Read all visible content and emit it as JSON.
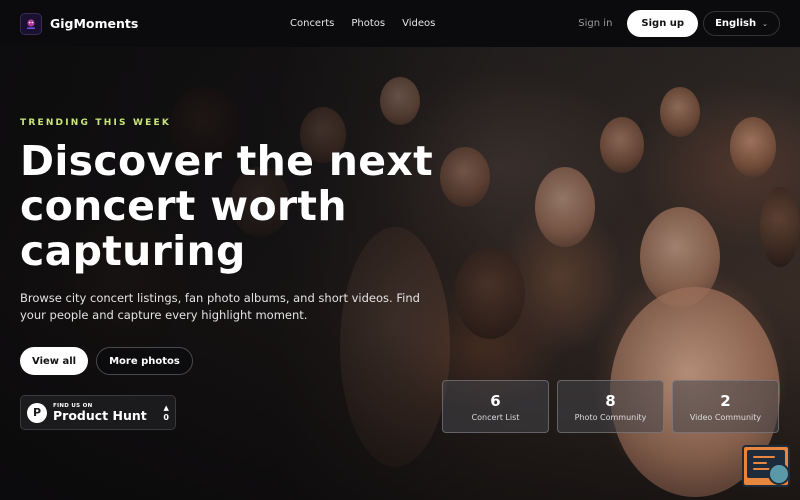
{
  "brand": {
    "name": "GigMoments"
  },
  "nav": {
    "links": [
      "Concerts",
      "Photos",
      "Videos"
    ],
    "signin": "Sign in",
    "signup": "Sign up",
    "language": "English"
  },
  "hero": {
    "eyebrow": "TRENDING THIS WEEK",
    "headline": "Discover the next concert worth capturing",
    "description": "Browse city concert listings, fan photo albums, and short videos. Find your people and capture every highlight moment.",
    "primary_cta": "View all",
    "secondary_cta": "More photos"
  },
  "product_hunt": {
    "small_text": "FIND US ON",
    "big_text": "Product Hunt",
    "votes": "0"
  },
  "stats": [
    {
      "value": "6",
      "label": "Concert List"
    },
    {
      "value": "8",
      "label": "Photo Community"
    },
    {
      "value": "2",
      "label": "Video Community"
    }
  ],
  "colors": {
    "accent": "#c8e67a",
    "nav_bg": "#0b0b0d",
    "widget": "#e8853f"
  },
  "icons": {
    "brand_logo": "brand-logo-icon",
    "language_chevron": "chevron-down-icon",
    "product_hunt": "product-hunt-logo-icon",
    "upvote": "upvote-arrow-icon",
    "widget": "code-search-icon"
  }
}
